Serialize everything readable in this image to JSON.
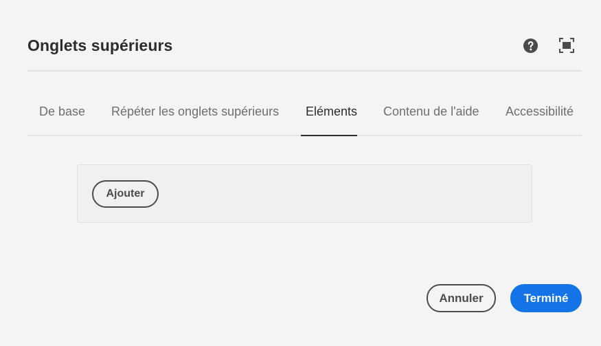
{
  "dialog": {
    "title": "Onglets supérieurs",
    "help_icon": "help-circle-icon",
    "fullscreen_icon": "fullscreen-icon"
  },
  "tabs": [
    {
      "label": "De base",
      "active": false
    },
    {
      "label": "Répéter les onglets supérieurs",
      "active": false
    },
    {
      "label": "Eléments",
      "active": true
    },
    {
      "label": "Contenu de l'aide",
      "active": false
    },
    {
      "label": "Accessibilité",
      "active": false
    }
  ],
  "panel": {
    "add_label": "Ajouter"
  },
  "footer": {
    "cancel_label": "Annuler",
    "done_label": "Terminé"
  },
  "colors": {
    "background": "#f4f4f4",
    "primary": "#1473e6",
    "text": "#2c2c2c",
    "muted_text": "#6e6e6e"
  }
}
